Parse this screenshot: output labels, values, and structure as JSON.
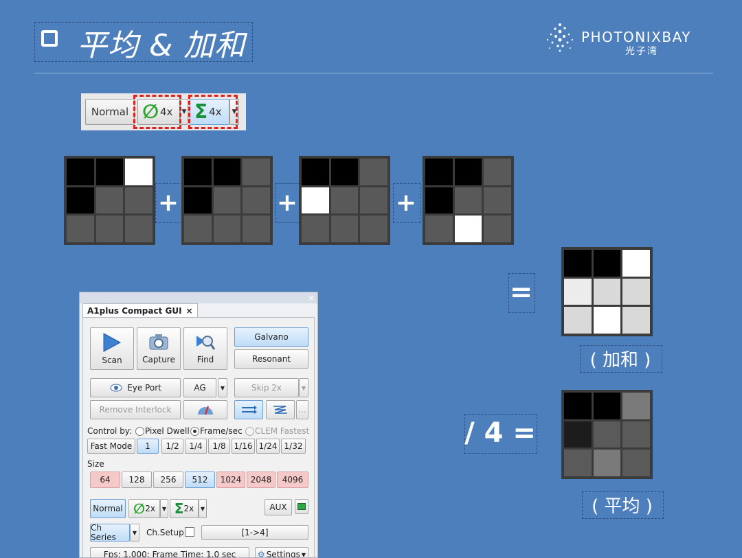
{
  "title": {
    "text": "平均 & 加和"
  },
  "logo": {
    "name": "PHOTONIXBAY",
    "cn": "光子湾"
  },
  "mini_toolbar": {
    "normal": "Normal",
    "avg_value": "4x",
    "sum_value": "4x"
  },
  "operators": {
    "plus": "+",
    "equals": "=",
    "divide": "/ 4 ="
  },
  "captions": {
    "sum": "( 加和 )",
    "avg": "( 平均 )"
  },
  "grids": {
    "input_1": [
      "#000000",
      "#000000",
      "#ffffff",
      "#000000",
      "#595959",
      "#595959",
      "#595959",
      "#595959",
      "#595959"
    ],
    "input_2": [
      "#000000",
      "#000000",
      "#595959",
      "#000000",
      "#595959",
      "#595959",
      "#595959",
      "#595959",
      "#595959"
    ],
    "input_3": [
      "#000000",
      "#000000",
      "#595959",
      "#ffffff",
      "#595959",
      "#595959",
      "#595959",
      "#595959",
      "#595959"
    ],
    "input_4": [
      "#000000",
      "#000000",
      "#595959",
      "#000000",
      "#595959",
      "#595959",
      "#595959",
      "#ffffff",
      "#595959"
    ],
    "sum": [
      "#000000",
      "#000000",
      "#ffffff",
      "#ececec",
      "#d9d9d9",
      "#d9d9d9",
      "#d9d9d9",
      "#ffffff",
      "#d9d9d9"
    ],
    "avg": [
      "#000000",
      "#000000",
      "#7a7a7a",
      "#1c1c1c",
      "#5a5a5a",
      "#5a5a5a",
      "#5a5a5a",
      "#7a7a7a",
      "#5a5a5a"
    ]
  },
  "gui": {
    "tab_title": "A1plus Compact GUI",
    "tab_close": "×",
    "panel_close": "×",
    "scan": "Scan",
    "capture": "Capture",
    "find": "Find",
    "galvano": "Galvano",
    "resonant": "Resonant",
    "eye_port": "Eye Port",
    "ag": "AG",
    "skip": "Skip 2x",
    "remove_interlock": "Remove Interlock",
    "ellipsis": "...",
    "control_by": "Control by:",
    "pixel_dwell": "Pixel Dwell",
    "frame_sec": "Frame/sec",
    "clem_fastest": "CLEM Fastest",
    "fast_mode": "Fast Mode",
    "fast_options": [
      "1",
      "1/2",
      "1/4",
      "1/8",
      "1/16",
      "1/24",
      "1/32"
    ],
    "size_label": "Size",
    "sizes": [
      "64",
      "128",
      "256",
      "512",
      "1024",
      "2048",
      "4096"
    ],
    "normal": "Normal",
    "avg_value": "2x",
    "sum_value": "2x",
    "aux": "AUX",
    "ch_series": "Ch Series",
    "ch_setup": "Ch.Setup",
    "channel_range": "[1->4]",
    "status": "Fps: 1.000; Frame Time: 1.0 sec",
    "settings": "Settings"
  }
}
